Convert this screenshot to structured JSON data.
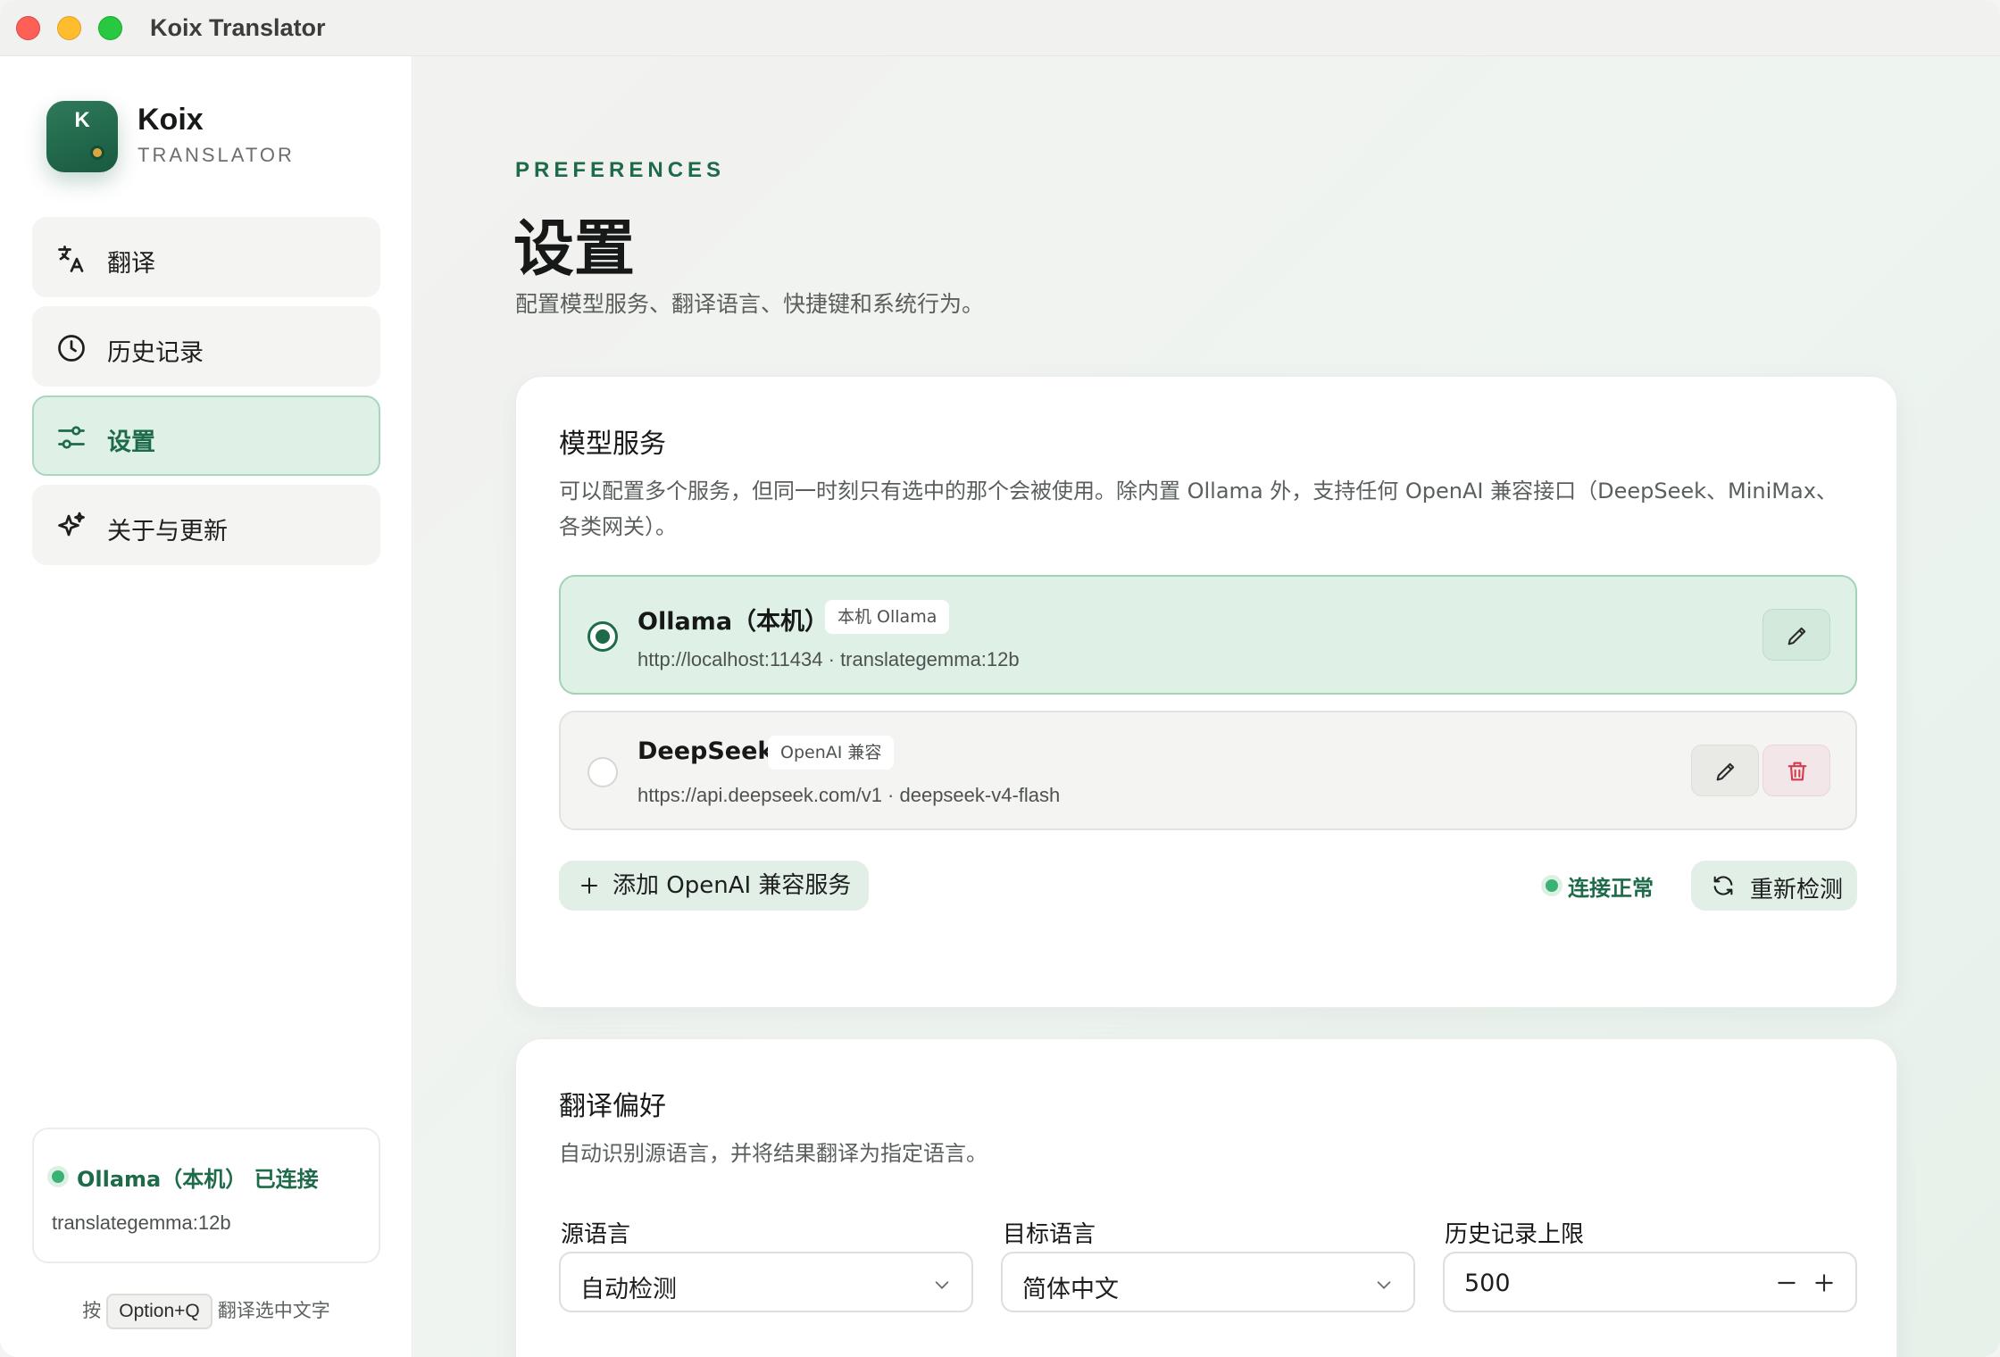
{
  "window": {
    "title": "Koix Translator"
  },
  "brand": {
    "logo_letter": "K",
    "name": "Koix",
    "subtitle": "TRANSLATOR"
  },
  "sidebar": {
    "items": [
      {
        "label": "翻译",
        "icon": "translate-icon",
        "active": false
      },
      {
        "label": "历史记录",
        "icon": "clock-icon",
        "active": false
      },
      {
        "label": "设置",
        "icon": "sliders-icon",
        "active": true
      },
      {
        "label": "关于与更新",
        "icon": "sparkles-icon",
        "active": false
      }
    ],
    "status": {
      "text": "Ollama（本机） 已连接",
      "model": "translategemma:12b",
      "color": "#3bb273"
    },
    "hint": {
      "prefix": "按",
      "shortcut": "Option+Q",
      "suffix": "翻译选中文字"
    }
  },
  "header": {
    "eyebrow": "PREFERENCES",
    "title": "设置",
    "description": "配置模型服务、翻译语言、快捷键和系统行为。"
  },
  "services_card": {
    "title": "模型服务",
    "description": "可以配置多个服务，但同一时刻只有选中的那个会被使用。除内置 Ollama 外，支持任何 OpenAI 兼容接口（DeepSeek、MiniMax、各类网关）。",
    "services": [
      {
        "name": "Ollama（本机）",
        "tag": "本机 Ollama",
        "url": "http://localhost:11434 · translategemma:12b",
        "selected": true
      },
      {
        "name": "DeepSeek",
        "tag": "OpenAI 兼容",
        "url": "https://api.deepseek.com/v1 · deepseek-v4-flash",
        "selected": false
      }
    ],
    "add_label": "添加 OpenAI 兼容服务",
    "connection_status": "连接正常",
    "recheck_label": "重新检测"
  },
  "prefs_card": {
    "title": "翻译偏好",
    "description": "自动识别源语言，并将结果翻译为指定语言。",
    "source_label": "源语言",
    "source_value": "自动检测",
    "target_label": "目标语言",
    "target_value": "简体中文",
    "history_label": "历史记录上限",
    "history_value": "500"
  },
  "colors": {
    "accent": "#1d6b49",
    "accent_bg": "#dff0e6",
    "danger": "#d23b4e"
  }
}
